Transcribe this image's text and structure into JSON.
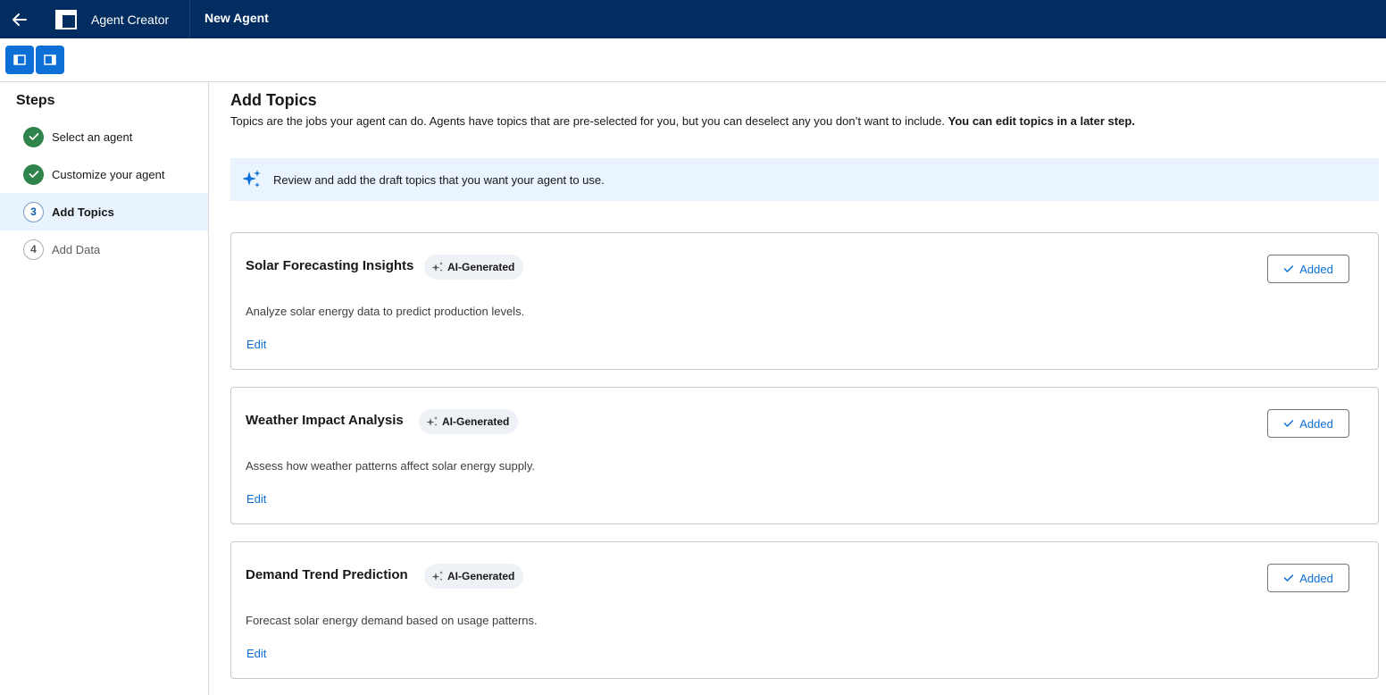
{
  "header": {
    "app_name": "Agent Creator",
    "page_name": "New Agent",
    "back_icon": "arrow-left-icon",
    "app_icon": "layout-icon",
    "color": "#032d60"
  },
  "toolbar": {
    "left_panel_icon": "left-panel-toggle-icon",
    "right_panel_icon": "right-panel-toggle-icon",
    "accent": "#0b6fd6"
  },
  "sidebar": {
    "title": "Steps",
    "steps": [
      {
        "number": "1",
        "label": "Select an agent",
        "status": "complete"
      },
      {
        "number": "2",
        "label": "Customize your agent",
        "status": "complete"
      },
      {
        "number": "3",
        "label": "Add Topics",
        "status": "current"
      },
      {
        "number": "4",
        "label": "Add Data",
        "status": "upcoming"
      }
    ]
  },
  "main": {
    "title": "Add Topics",
    "description": "Topics are the jobs your agent can do. Agents have topics that are pre-selected for you, but you can deselect any you don’t want to include.",
    "description_bold": "You can edit topics in a later step.",
    "info": "Review and add the draft topics that you want your agent to use.",
    "topics": [
      {
        "title": "Solar Forecasting Insights",
        "badge": "AI-Generated",
        "description": "Analyze solar energy data to predict production levels.",
        "edit": "Edit",
        "button": "Added"
      },
      {
        "title": "Weather Impact Analysis",
        "badge": "AI-Generated",
        "description": "Assess how weather patterns affect solar energy supply.",
        "edit": "Edit",
        "button": "Added"
      },
      {
        "title": "Demand Trend Prediction",
        "badge": "AI-Generated",
        "description": "Forecast solar energy demand based on usage patterns.",
        "edit": "Edit",
        "button": "Added"
      }
    ]
  }
}
